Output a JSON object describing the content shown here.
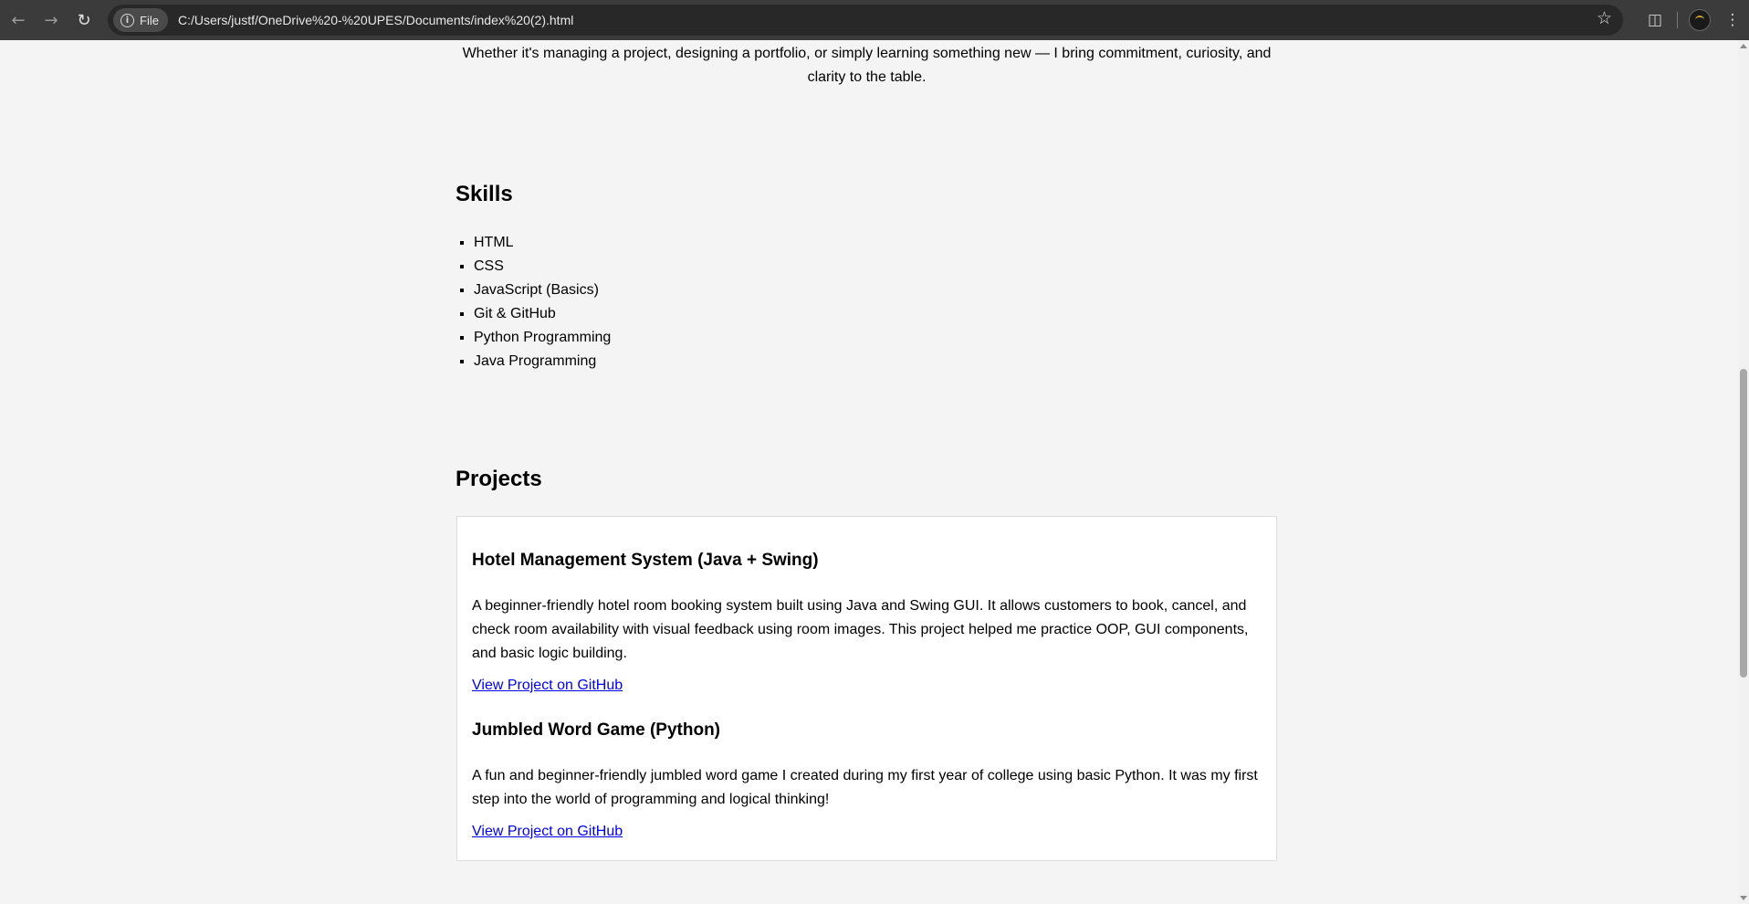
{
  "browser": {
    "chip_label": "File",
    "url": "C:/Users/justf/OneDrive%20-%20UPES/Documents/index%20(2).html"
  },
  "intro_text": "Whether it's managing a project, designing a portfolio, or simply learning something new — I bring commitment, curiosity, and clarity to the table.",
  "skills": {
    "title": "Skills",
    "items": [
      "HTML",
      "CSS",
      "JavaScript (Basics)",
      "Git & GitHub",
      "Python Programming",
      "Java Programming"
    ]
  },
  "projects": {
    "title": "Projects",
    "items": [
      {
        "title": "Hotel Management System (Java + Swing)",
        "description": "A beginner-friendly hotel room booking system built using Java and Swing GUI. It allows customers to book, cancel, and check room availability with visual feedback using room images. This project helped me practice OOP, GUI components, and basic logic building.",
        "link": "View Project on GitHub"
      },
      {
        "title": "Jumbled Word Game (Python)",
        "description": "A fun and beginner-friendly jumbled word game I created during my first year of college using basic Python. It was my first step into the world of programming and logical thinking!",
        "link": "View Project on GitHub"
      }
    ]
  }
}
